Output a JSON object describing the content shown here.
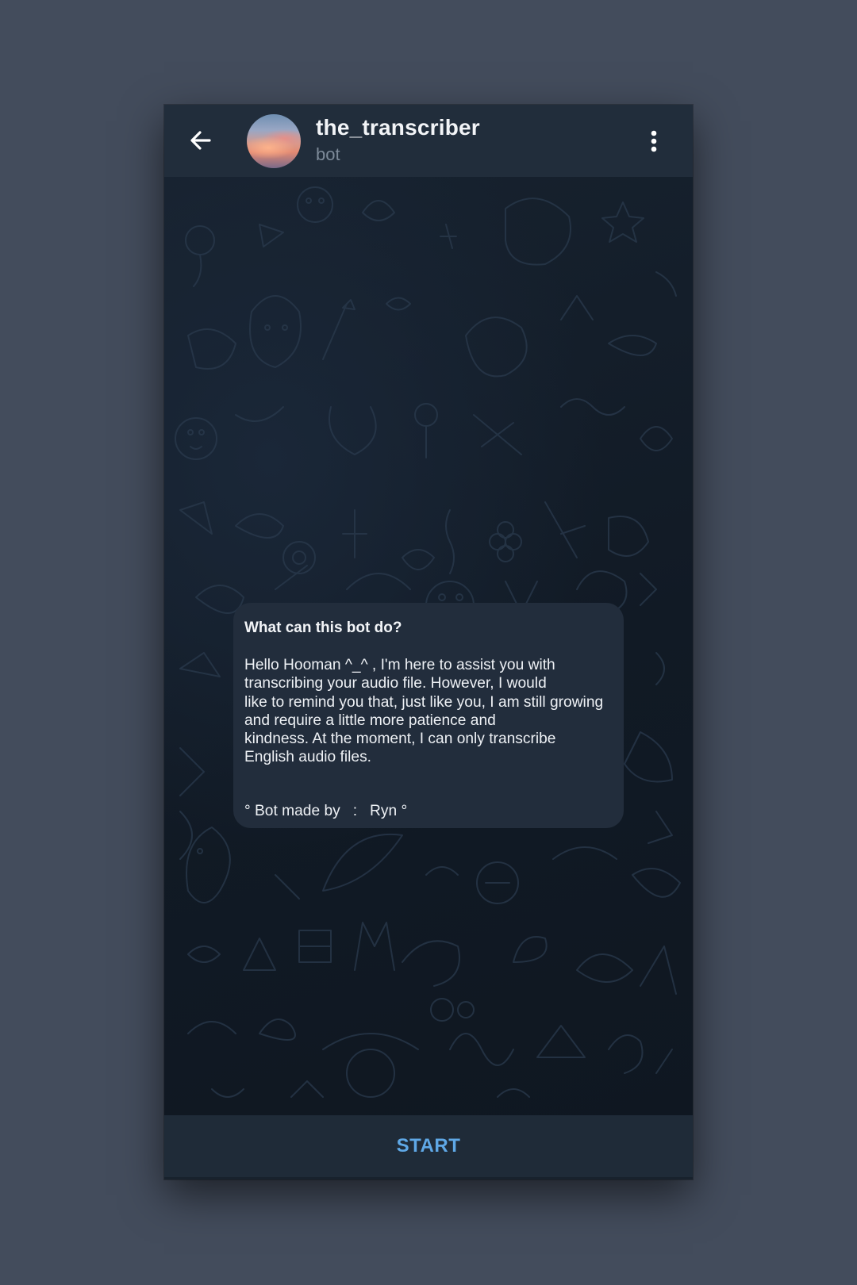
{
  "header": {
    "title": "the_transcriber",
    "subtitle": "bot"
  },
  "message": {
    "title": "What can this bot do?",
    "body": "Hello Hooman ^_^ , I'm  here to assist you with\ntranscribing your audio file. However, I would\nlike to remind you that, just like you, I am still growing\nand require a little more patience and\nkindness. At the moment, I can only transcribe\nEnglish audio files.",
    "footer": "° Bot made by   :   Ryn °"
  },
  "bottom_bar": {
    "start_label": "START"
  },
  "icons": {
    "back": "arrow-left-icon",
    "menu": "more-vertical-icon",
    "avatar": "sunset-sky-avatar"
  },
  "colors": {
    "page_background": "#434c5c",
    "header_background": "#212d3b",
    "bubble_background": "#222d3c",
    "accent": "#5fa8e6"
  }
}
